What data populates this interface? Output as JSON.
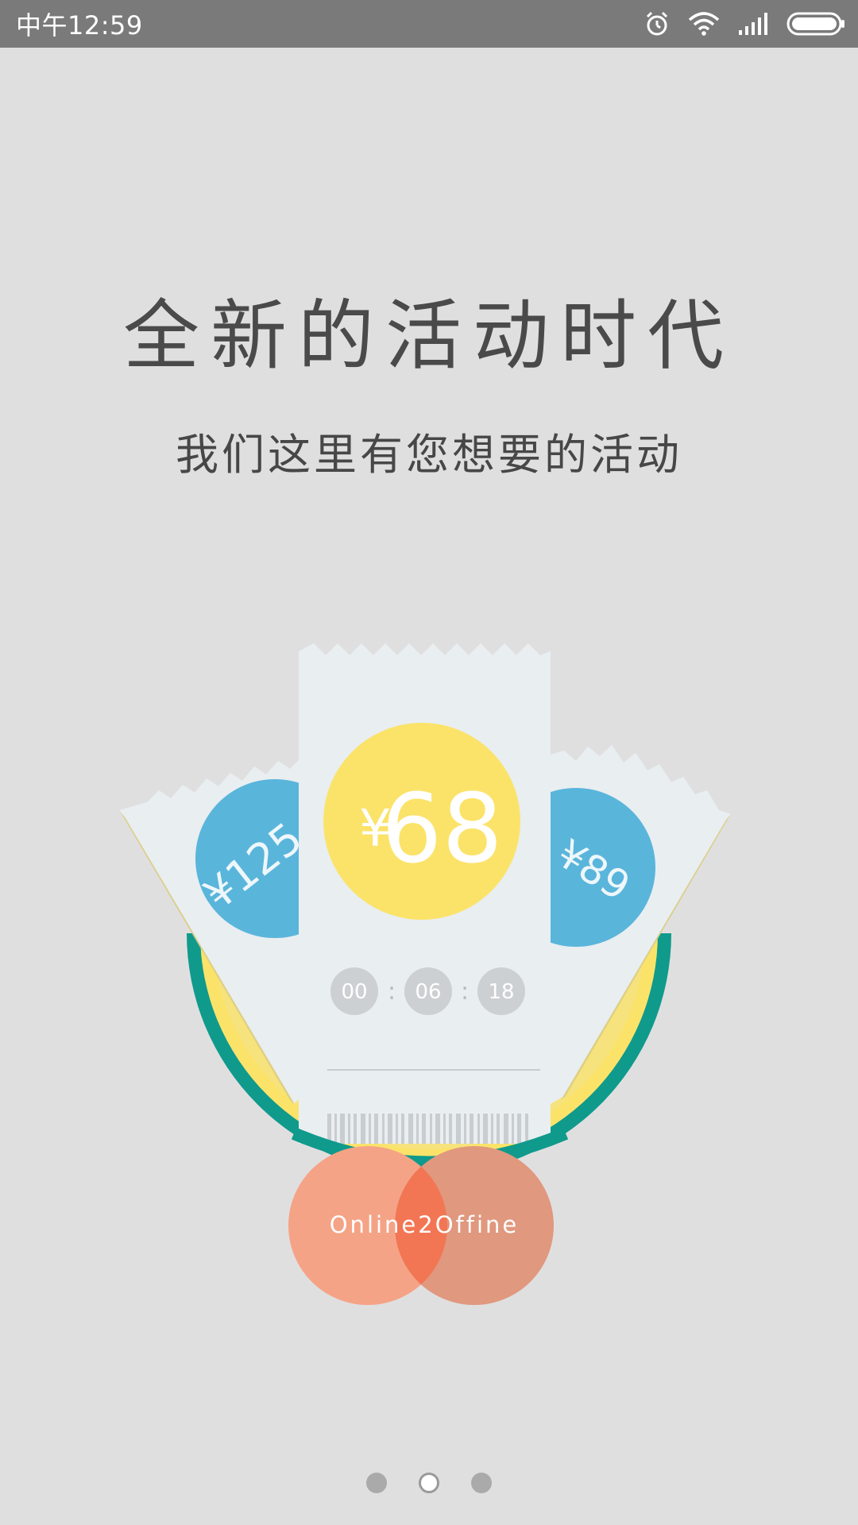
{
  "status_bar": {
    "time": "中午12:59",
    "icons": [
      "alarm-icon",
      "wifi-icon",
      "signal-icon",
      "battery-icon"
    ]
  },
  "onboarding": {
    "title": "全新的活动时代",
    "subtitle": "我们这里有您想要的活动"
  },
  "illustration": {
    "center_price": "68",
    "currency": "¥",
    "left_price": "¥125",
    "right_price": "¥89",
    "countdown": [
      "00",
      "06",
      "18"
    ],
    "separator": ":",
    "venn_label": "Online2Offine",
    "colors": {
      "yellow": "#fbe36a",
      "blue": "#5ab5db",
      "teal": "#0f9a8c",
      "ticket": "#e9eef1",
      "venn_left": "#f5a386",
      "venn_right": "#e0987e",
      "venn_overlap": "#f27654"
    }
  },
  "pager": {
    "pages": 3,
    "current_page": 2
  }
}
